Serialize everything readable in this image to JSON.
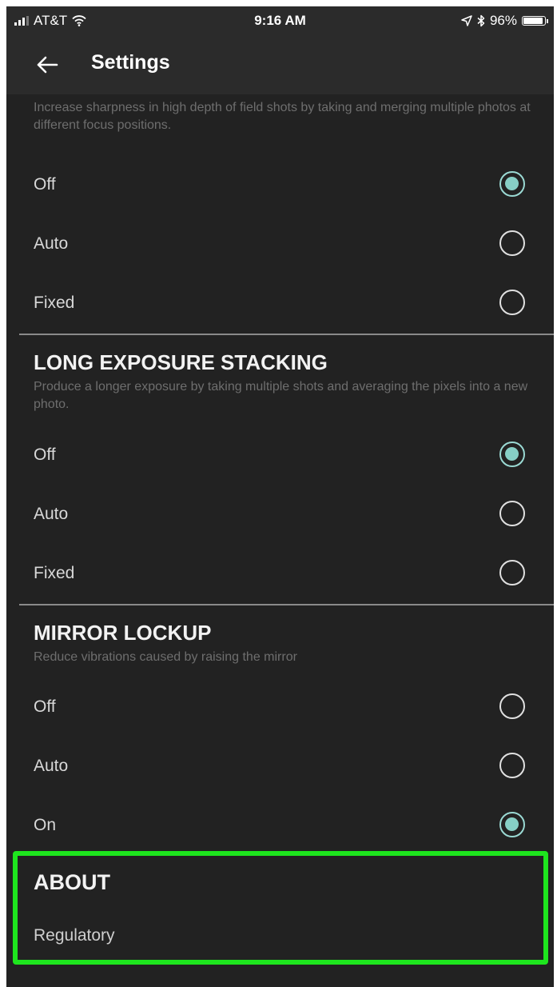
{
  "status_bar": {
    "carrier": "AT&T",
    "time": "9:16 AM",
    "battery": "96%",
    "battery_level": 0.96,
    "icons": [
      "signal-icon",
      "wifi-icon",
      "location-icon",
      "bluetooth-icon",
      "battery-icon"
    ]
  },
  "header": {
    "title": "Settings",
    "back_icon": "arrow-left-icon"
  },
  "sections": {
    "focus_stacking": {
      "description": "Increase sharpness in high depth of field shots by taking and merging multiple photos at different focus positions.",
      "options": [
        {
          "label": "Off",
          "selected": true
        },
        {
          "label": "Auto",
          "selected": false
        },
        {
          "label": "Fixed",
          "selected": false
        }
      ]
    },
    "long_exposure": {
      "title": "LONG EXPOSURE STACKING",
      "description": "Produce a longer exposure by taking multiple shots and averaging the pixels into a new photo.",
      "options": [
        {
          "label": "Off",
          "selected": true
        },
        {
          "label": "Auto",
          "selected": false
        },
        {
          "label": "Fixed",
          "selected": false
        }
      ]
    },
    "mirror_lockup": {
      "title": "MIRROR LOCKUP",
      "description": "Reduce vibrations caused by raising the mirror",
      "options": [
        {
          "label": "Off",
          "selected": false
        },
        {
          "label": "Auto",
          "selected": false
        },
        {
          "label": "On",
          "selected": true
        }
      ]
    },
    "about": {
      "title": "ABOUT",
      "items": [
        {
          "label": "Regulatory"
        }
      ]
    }
  },
  "colors": {
    "background": "#222222",
    "radio_selected": "#87cfc6",
    "highlight_border": "#1ee61e"
  }
}
